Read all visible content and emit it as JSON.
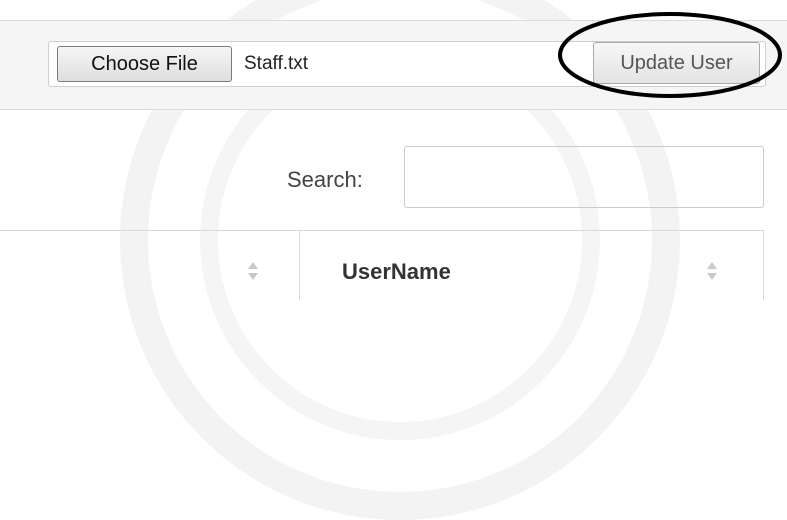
{
  "upload": {
    "choose_label": "Choose File",
    "file_name": "Staff.txt",
    "update_label": "Update User"
  },
  "search": {
    "label": "Search:",
    "value": "",
    "placeholder": ""
  },
  "table": {
    "columns": [
      {
        "label": ""
      },
      {
        "label": "UserName"
      }
    ]
  },
  "icons": {
    "sort": "sort-both-icon"
  },
  "colors": {
    "panel_bg": "#f5f5f5",
    "annotation": "#000000"
  }
}
